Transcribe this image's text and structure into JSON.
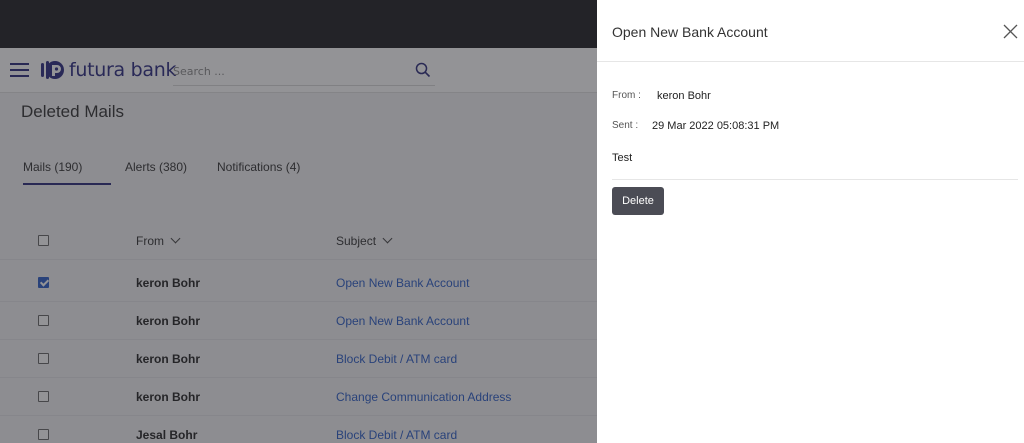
{
  "app": {
    "logo_text": "futura bank",
    "search": {
      "placeholder": "Search ..."
    },
    "page_title": "Deleted Mails",
    "tabs": [
      {
        "label": "Mails (190)",
        "active": true
      },
      {
        "label": "Alerts (380)",
        "active": false
      },
      {
        "label": "Notifications (4)",
        "active": false
      }
    ],
    "table": {
      "headers": {
        "from": "From",
        "subject": "Subject"
      },
      "rows": [
        {
          "from": "keron Bohr",
          "subject": "Open New Bank Account",
          "checked": true
        },
        {
          "from": "keron Bohr",
          "subject": "Open New Bank Account",
          "checked": false
        },
        {
          "from": "keron Bohr",
          "subject": "Block Debit / ATM card",
          "checked": false
        },
        {
          "from": "keron Bohr",
          "subject": "Change Communication Address",
          "checked": false
        },
        {
          "from": "Jesal Bohr",
          "subject": "Block Debit / ATM card",
          "checked": false
        }
      ]
    }
  },
  "panel": {
    "title": "Open New Bank Account",
    "from_label": "From :",
    "from_value": "keron Bohr",
    "sent_label": "Sent :",
    "sent_value": "29 Mar 2022 05:08:31 PM",
    "body": "Test",
    "delete_label": "Delete"
  },
  "colors": {
    "brand": "#2a2a80",
    "link": "#2b5dc7",
    "topbar": "#1e1e22",
    "delete_button": "#4b4c55"
  },
  "icons": [
    "hamburger-menu-icon",
    "futura-logo-icon",
    "search-icon",
    "close-icon",
    "chevron-down-icon"
  ]
}
